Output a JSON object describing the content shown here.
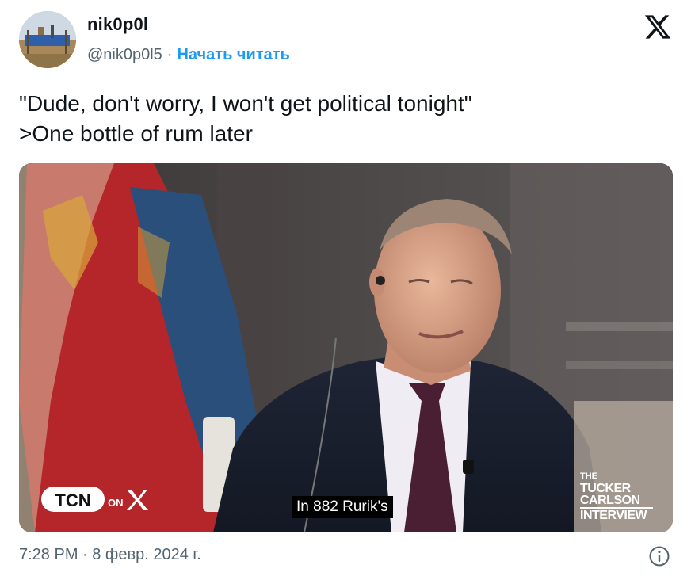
{
  "author": {
    "display_name": "nik0p0l",
    "handle": "@nik0p0l5",
    "separator": "·",
    "follow_label": "Начать читать"
  },
  "platform_icon": "x-logo-icon",
  "tweet": {
    "lines": [
      "\"Dude, don't worry, I won't get political tonight\"",
      ">One bottle of rum later"
    ]
  },
  "media": {
    "caption": "In 882 Rurik's",
    "left_logo": {
      "tcn": "TCN",
      "on": "ON",
      "x": "X"
    },
    "right_logo": {
      "the": "THE",
      "line1": "TUCKER",
      "line2": "CARLSON",
      "line3": "INTERVIEW"
    }
  },
  "footer": {
    "timestamp": "7:28 PM · 8 февр. 2024 г.",
    "info_icon": "info-icon"
  },
  "colors": {
    "link": "#1d9bf0",
    "secondary_text": "#536471",
    "primary_text": "#0f1419"
  }
}
